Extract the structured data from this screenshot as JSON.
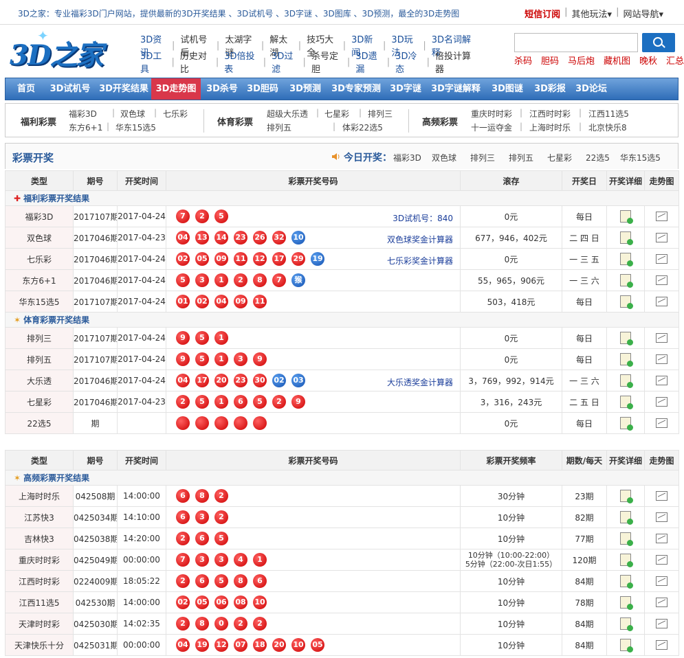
{
  "topbar": {
    "intro": "3D之家：专业福彩3D门户网站，提供最新的3D开奖结果 、3D试机号 、3D字谜 、3D图库 、3D预测，最全的3D走势图",
    "sms": "短信订阅",
    "other": "其他玩法",
    "sitenav": "网站导航"
  },
  "logo": {
    "text": "3D之家"
  },
  "mainlinks": {
    "row1": [
      "3D资讯",
      "试机号后",
      "太湖字谜",
      "解太湖",
      "技巧大全",
      "3D新闻",
      "3D玩法",
      "3D名词解释"
    ],
    "row2": [
      "3D工具",
      "历史对比",
      "3D倍投表",
      "3D过滤",
      "杀号定胆",
      "3D遗漏",
      "3D冷态",
      "倍投计算器"
    ]
  },
  "hotlinks": [
    "杀码",
    "胆码",
    "马后炮",
    "藏机图",
    "晚秋",
    "汇总"
  ],
  "nav": [
    "首页",
    "3D试机号",
    "3D开奖结果",
    "3D走势图",
    "3D杀号",
    "3D胆码",
    "3D预测",
    "3D专家预测",
    "3D字谜",
    "3D字谜解释",
    "3D图谜",
    "3D彩报",
    "3D论坛"
  ],
  "subnav": {
    "fuli": "福利彩票",
    "fuli_links": [
      "福彩3D",
      "双色球",
      "七乐彩",
      "东方6+1",
      "华东15选5"
    ],
    "tiyu": "体育彩票",
    "tiyu_links": [
      "超级大乐透",
      "七星彩",
      "排列三",
      "排列五",
      "体彩22选5"
    ],
    "gaopin": "高频彩票",
    "gaopin_links": [
      "重庆时时彩",
      "江西时时彩",
      "江西11选5",
      "十一运夺金",
      "上海时时乐",
      "北京快乐8"
    ]
  },
  "kaijiang": {
    "title": "彩票开奖",
    "today": "今日开奖：",
    "today_links": [
      "福彩3D",
      "双色球",
      "排列三",
      "排列五",
      "七星彩",
      "22选5",
      "华东15选5"
    ]
  },
  "table1": {
    "headers": [
      "类型",
      "期号",
      "开奖时间",
      "彩票开奖号码",
      "滚存",
      "开奖日",
      "开奖详细",
      "走势图"
    ],
    "sec_fuli": "福利彩票开奖结果",
    "sec_tiyu": "体育彩票开奖结果",
    "rows_fuli": [
      {
        "name": "福彩3D",
        "issue": "2017107期",
        "date": "2017-04-24",
        "red": [
          "7",
          "2",
          "5"
        ],
        "blue": [],
        "extra": "3D试机号：840",
        "pool": "0元",
        "day": "每日"
      },
      {
        "name": "双色球",
        "issue": "2017046期",
        "date": "2017-04-23",
        "red": [
          "04",
          "13",
          "14",
          "23",
          "26",
          "32"
        ],
        "blue": [
          "10"
        ],
        "extra": "双色球奖金计算器",
        "pool": "677，946，402元",
        "day": "二 四 日"
      },
      {
        "name": "七乐彩",
        "issue": "2017046期",
        "date": "2017-04-24",
        "red": [
          "02",
          "05",
          "09",
          "11",
          "12",
          "17",
          "29"
        ],
        "blue": [
          "19"
        ],
        "extra": "七乐彩奖金计算器",
        "pool": "0元",
        "day": "一 三 五"
      },
      {
        "name": "东方6+1",
        "issue": "2017046期",
        "date": "2017-04-24",
        "red": [
          "5",
          "3",
          "1",
          "2",
          "8",
          "7"
        ],
        "blue": [
          "猴"
        ],
        "extra": "",
        "pool": "55，965，906元",
        "day": "一 三 六"
      },
      {
        "name": "华东15选5",
        "issue": "2017107期",
        "date": "2017-04-24",
        "red": [
          "01",
          "02",
          "04",
          "09",
          "11"
        ],
        "blue": [],
        "extra": "",
        "pool": "503，418元",
        "day": "每日"
      }
    ],
    "rows_tiyu": [
      {
        "name": "排列三",
        "issue": "2017107期",
        "date": "2017-04-24",
        "red": [
          "9",
          "5",
          "1"
        ],
        "blue": [],
        "extra": "",
        "pool": "0元",
        "day": "每日"
      },
      {
        "name": "排列五",
        "issue": "2017107期",
        "date": "2017-04-24",
        "red": [
          "9",
          "5",
          "1",
          "3",
          "9"
        ],
        "blue": [],
        "extra": "",
        "pool": "0元",
        "day": "每日"
      },
      {
        "name": "大乐透",
        "issue": "2017046期",
        "date": "2017-04-24",
        "red": [
          "04",
          "17",
          "20",
          "23",
          "30"
        ],
        "blue": [
          "02",
          "03"
        ],
        "extra": "大乐透奖金计算器",
        "pool": "3，769，992，914元",
        "day": "一 三 六"
      },
      {
        "name": "七星彩",
        "issue": "2017046期",
        "date": "2017-04-23",
        "red": [
          "2",
          "5",
          "1",
          "6",
          "5",
          "2",
          "9"
        ],
        "blue": [],
        "extra": "",
        "pool": "3，316，243元",
        "day": "二 五 日"
      },
      {
        "name": "22选5",
        "issue": "期",
        "date": "",
        "red": [
          "",
          "",
          "",
          "",
          ""
        ],
        "blue": [],
        "extra": "",
        "pool": "0元",
        "day": "每日"
      }
    ]
  },
  "table2": {
    "headers": [
      "类型",
      "期号",
      "开奖时间",
      "彩票开奖号码",
      "彩票开奖频率",
      "期数/每天",
      "开奖详细",
      "走势图"
    ],
    "sec_gaopin": "高频彩票开奖结果",
    "rows": [
      {
        "name": "上海时时乐",
        "issue": "042508期",
        "time": "14:00:00",
        "red": [
          "6",
          "8",
          "2"
        ],
        "freq": "30分钟",
        "freq2": "",
        "count": "23期"
      },
      {
        "name": "江苏快3",
        "issue": "0425034期",
        "time": "14:10:00",
        "red": [
          "6",
          "3",
          "2"
        ],
        "freq": "10分钟",
        "freq2": "",
        "count": "82期"
      },
      {
        "name": "吉林快3",
        "issue": "0425038期",
        "time": "14:20:00",
        "red": [
          "2",
          "6",
          "5"
        ],
        "freq": "10分钟",
        "freq2": "",
        "count": "77期"
      },
      {
        "name": "重庆时时彩",
        "issue": "0425049期",
        "time": "00:00:00",
        "red": [
          "7",
          "3",
          "3",
          "4",
          "1"
        ],
        "freq": "10分钟（10:00-22:00）",
        "freq2": "5分钟（22:00-次日1:55）",
        "count": "120期"
      },
      {
        "name": "江西时时彩",
        "issue": "0224009期",
        "time": "18:05:22",
        "red": [
          "2",
          "6",
          "5",
          "8",
          "6"
        ],
        "freq": "10分钟",
        "freq2": "",
        "count": "84期"
      },
      {
        "name": "江西11选5",
        "issue": "042530期",
        "time": "14:00:00",
        "red": [
          "02",
          "05",
          "06",
          "08",
          "10"
        ],
        "freq": "10分钟",
        "freq2": "",
        "count": "78期"
      },
      {
        "name": "天津时时彩",
        "issue": "0425030期",
        "time": "14:02:35",
        "red": [
          "2",
          "8",
          "0",
          "2",
          "2"
        ],
        "freq": "10分钟",
        "freq2": "",
        "count": "84期"
      },
      {
        "name": "天津快乐十分",
        "issue": "0425031期",
        "time": "00:00:00",
        "red": [
          "04",
          "19",
          "12",
          "07",
          "18",
          "20",
          "10",
          "05"
        ],
        "freq": "10分钟",
        "freq2": "",
        "count": "84期"
      }
    ]
  }
}
